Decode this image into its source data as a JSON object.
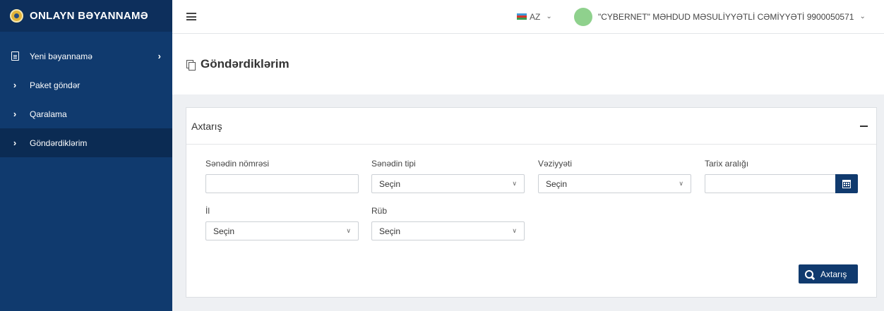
{
  "brand": {
    "title": "ONLAYN BƏYANNAMƏ"
  },
  "sidebar": {
    "items": [
      {
        "label": "Yeni bəyannamə",
        "icon": "document-icon",
        "arrow": "›"
      },
      {
        "label": "Paket göndər",
        "icon": "chevron-right-icon"
      },
      {
        "label": "Qaralama",
        "icon": "chevron-right-icon"
      },
      {
        "label": "Göndərdiklərim",
        "icon": "chevron-right-icon",
        "active": true
      }
    ]
  },
  "topbar": {
    "language": "AZ",
    "user_name": "\"CYBERNET\" MƏHDUD MƏSULİYYƏTLİ CƏMİYYƏTİ 9900050571"
  },
  "page": {
    "title": "Göndərdiklərim"
  },
  "search_panel": {
    "title": "Axtarış",
    "fields": {
      "doc_number": {
        "label": "Sənədin nömrəsi",
        "value": ""
      },
      "doc_type": {
        "label": "Sənədin tipi",
        "value": "Seçin"
      },
      "status": {
        "label": "Vəziyyəti",
        "value": "Seçin"
      },
      "date_range": {
        "label": "Tarix aralığı",
        "value": ""
      },
      "year": {
        "label": "İl",
        "value": "Seçin"
      },
      "quarter": {
        "label": "Rüb",
        "value": "Seçin"
      }
    },
    "search_button": "Axtarış"
  },
  "colors": {
    "primary": "#103a6e",
    "sidebar_active": "#0b2b53",
    "brand_bar": "#0d2f5c",
    "avatar": "#8fd18d"
  }
}
